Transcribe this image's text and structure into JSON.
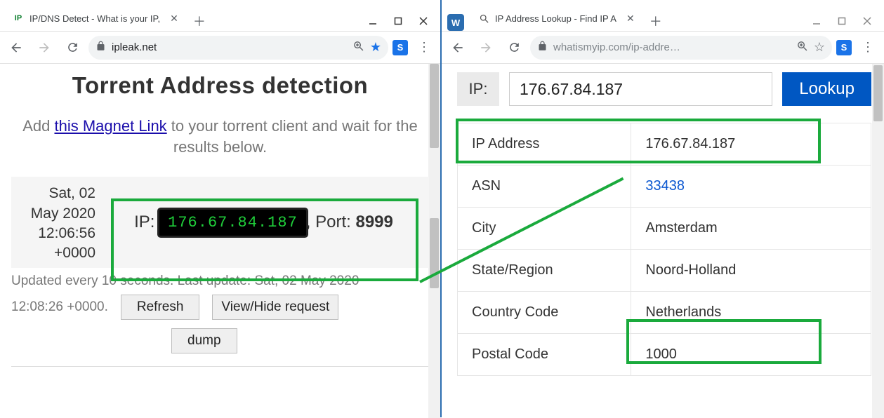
{
  "left": {
    "window": {
      "tab_title": "IP/DNS Detect - What is your IP,"
    },
    "toolbar": {
      "url_display": "ipleak.net"
    },
    "page": {
      "title": "Torrent Address detection",
      "subtext_pre": "Add ",
      "subtext_link": "this Magnet Link",
      "subtext_post": " to your torrent client and wait for the results below.",
      "timestamp": "Sat, 02 May 2020 12:06:56 +0000",
      "ip_label": "IP:",
      "ip_value": "176.67.84.187",
      "port_label": ", Port:",
      "port_value": "8999",
      "update_line": "Updated every 10 seconds. Last update: Sat, 02 May 2020",
      "update_ts": "12:08:26 +0000.",
      "btn_refresh": "Refresh",
      "btn_viewhide": "View/Hide request",
      "btn_dump": "dump"
    }
  },
  "right": {
    "window": {
      "tab_title": "IP Address Lookup - Find IP A"
    },
    "toolbar": {
      "url_display": "whatismyip.com/ip-addre…"
    },
    "page": {
      "ip_label": "IP:",
      "ip_input_value": "176.67.84.187",
      "lookup_btn": "Lookup",
      "rows": [
        {
          "k": "IP Address",
          "v": "176.67.84.187"
        },
        {
          "k": "ASN",
          "v": "33438",
          "link": true
        },
        {
          "k": "City",
          "v": "Amsterdam"
        },
        {
          "k": "State/Region",
          "v": "Noord-Holland"
        },
        {
          "k": "Country Code",
          "v": "Netherlands"
        },
        {
          "k": "Postal Code",
          "v": "1000"
        }
      ]
    }
  }
}
